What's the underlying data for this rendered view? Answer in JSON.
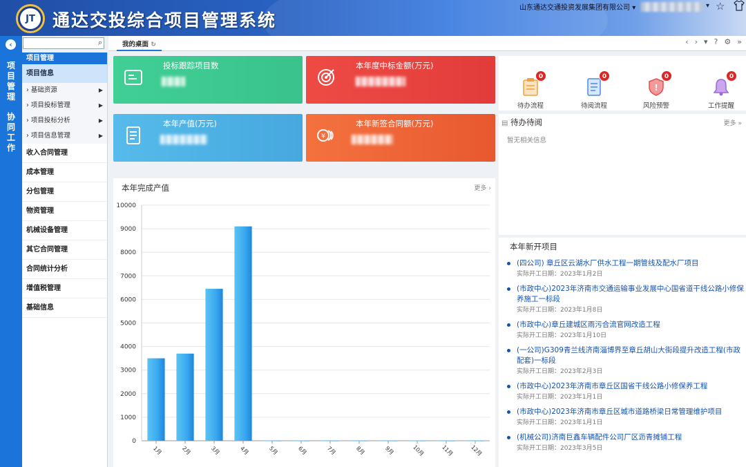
{
  "app": {
    "title": "通达交投综合项目管理系统",
    "logo_text": "JT"
  },
  "header": {
    "company": "山东通达交通投资发展集团有限公司"
  },
  "strip": {
    "group1": [
      "项",
      "目",
      "管",
      "理"
    ],
    "group2": [
      "协",
      "同",
      "工",
      "作"
    ]
  },
  "search": {
    "placeholder": ""
  },
  "menu": {
    "header": "项目管理",
    "sub": "项目信息",
    "children": [
      "基础资源",
      "项目投标管理",
      "项目投标分析",
      "项目信息管理"
    ],
    "items": [
      "收入合同管理",
      "成本管理",
      "分包管理",
      "物资管理",
      "机械设备管理",
      "其它合同管理",
      "合同统计分析",
      "增值税管理",
      "基础信息"
    ]
  },
  "tabs": {
    "active": "我的桌面"
  },
  "cards": {
    "bid_tracking": "投标跟踪项目数",
    "win_amount": "本年度中标金额(万元)",
    "output": "本年产值(万元)",
    "contracts": "本年新签合同额(万元)"
  },
  "notify": [
    {
      "label": "待办流程",
      "count": "0"
    },
    {
      "label": "待阅流程",
      "count": "0"
    },
    {
      "label": "风险预警",
      "count": "0"
    },
    {
      "label": "工作提醒",
      "count": "0"
    }
  ],
  "todo": {
    "title": "待办待阅",
    "more": "更多",
    "empty": "暂无相关信息"
  },
  "output_panel": {
    "title": "本年完成产值",
    "more": "更多"
  },
  "new_projects": {
    "title": "本年新开项目",
    "items": [
      {
        "name": "(四公司) 章丘区云湖水厂供水工程一期管线及配水厂项目",
        "date": "实际开工日期：2023年1月2日"
      },
      {
        "name": "(市政中心)2023年济南市交通运输事业发展中心国省道干线公路小修保养施工一标段",
        "date": "实际开工日期：2023年1月8日"
      },
      {
        "name": "(市政中心)章丘建城区雨污合流官网改造工程",
        "date": "实际开工日期：2023年1月10日"
      },
      {
        "name": "(一公司)G309青兰线济南淄博界至章丘胡山大街段提升改造工程(市政配套)一标段",
        "date": "实际开工日期：2023年2月3日"
      },
      {
        "name": "(市政中心)2023年济南市章丘区国省干线公路小修保养工程",
        "date": "实际开工日期：2023年1月1日"
      },
      {
        "name": "(市政中心)2023年济南市章丘区城市道路桥梁日常管理维护项目",
        "date": "实际开工日期：2023年1月1日"
      },
      {
        "name": "(机械公司)济南巨鑫车辆配件公司厂区沥青摊铺工程",
        "date": "实际开工日期：2023年3月5日"
      }
    ]
  },
  "colors": {
    "blue": "#1b74d9",
    "green": "#3ecb8f",
    "red": "#e8433f",
    "sky": "#4fb2e6",
    "orange": "#ee5e35"
  },
  "chart_data": {
    "type": "bar",
    "categories": [
      "1月",
      "2月",
      "3月",
      "4月",
      "5月",
      "6月",
      "7月",
      "8月",
      "9月",
      "10月",
      "11月",
      "12月"
    ],
    "values": [
      3500,
      3700,
      6450,
      9100,
      0,
      0,
      0,
      0,
      0,
      0,
      0,
      0
    ],
    "ylim": [
      0,
      10000
    ],
    "yticks": [
      0,
      1000,
      2000,
      3000,
      4000,
      5000,
      6000,
      7000,
      8000,
      9000,
      10000
    ],
    "grid": true,
    "legend": "none"
  }
}
